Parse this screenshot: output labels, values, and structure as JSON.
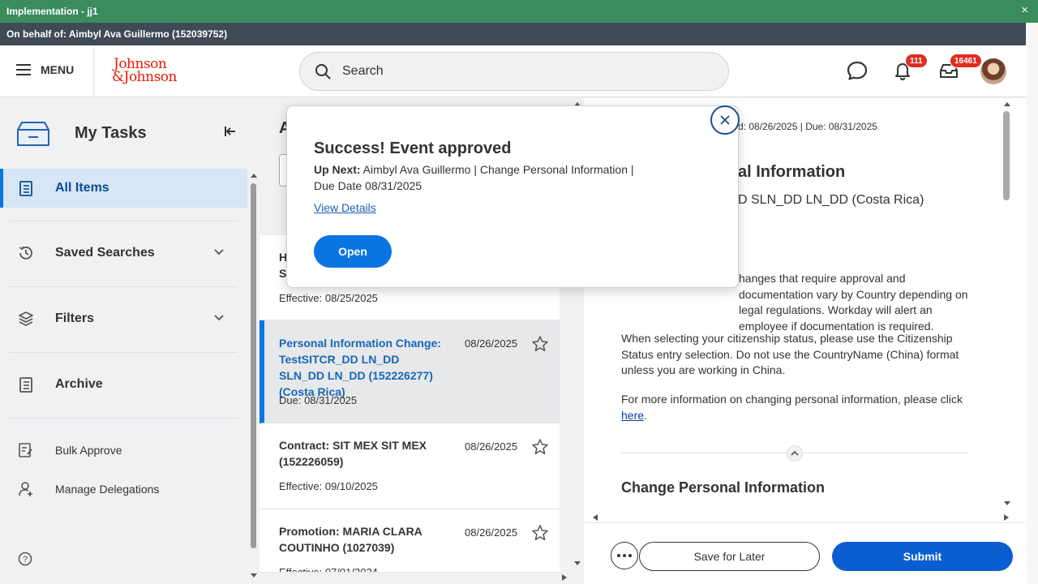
{
  "implementation_bar": {
    "title": "Implementation - jj1",
    "close": "×"
  },
  "behalf_bar": {
    "text": "On behalf of: Aimbyl Ava Guillermo (152039752)"
  },
  "header": {
    "menu_label": "MENU",
    "logo_line1": "Johnson",
    "logo_line2": "&Johnson",
    "search_placeholder": "Search",
    "notifications_count": "111",
    "inbox_count": "16461"
  },
  "sidebar": {
    "title": "My Tasks",
    "items": [
      {
        "label": "All Items"
      },
      {
        "label": "Saved Searches"
      },
      {
        "label": "Filters"
      },
      {
        "label": "Archive"
      },
      {
        "label": "Bulk Approve"
      },
      {
        "label": "Manage Delegations"
      }
    ]
  },
  "list": {
    "heading": "A",
    "tasks": [
      {
        "title_line1": "H",
        "title_line2": "S",
        "date": "",
        "sub": "Effective: 08/25/2025"
      },
      {
        "title": "Personal Information Change: TestSITCR_DD LN_DD SLN_DD LN_DD (152226277) (Costa Rica)",
        "date": "08/26/2025",
        "sub": "Due: 08/31/2025"
      },
      {
        "title": "Contract: SIT MEX SIT MEX (152226059)",
        "date": "08/26/2025",
        "sub": "Effective: 09/10/2025"
      },
      {
        "title": "Promotion: MARIA CLARA COUTINHO (1027039)",
        "date": "08/26/2025",
        "sub": "Effective: 07/01/2024"
      }
    ]
  },
  "detail": {
    "meta": "ted: 08/26/2025 | Due: 08/31/2025",
    "title": "al Information",
    "subtitle": "D SLN_DD LN_DD (Costa Rica)",
    "p1": "hanges that require approval and documentation vary by Country depending on legal regulations. Workday will alert an employee if documentation is required.",
    "p1_lead": "",
    "p2": "When selecting your citizenship status, please use the Citizenship Status entry selection.  Do not use the CountryName (China) format unless you are working in China.",
    "p3_text": "For more information on changing personal information, please click ",
    "p3_link": "here",
    "p3_end": ".",
    "section": "Change Personal Information",
    "save_label": "Save for Later",
    "submit_label": "Submit"
  },
  "popup": {
    "title": "Success! Event approved",
    "up_next_label": "Up Next:",
    "up_next_text": " Aimbyl Ava Guillermo | Change Personal Information | Due Date 08/31/2025",
    "link": "View Details",
    "open_label": "Open"
  },
  "colors": {
    "impl_bar": "#3a8c5c",
    "behalf_bar": "#3e4b57",
    "brand_red": "#eb1700",
    "primary_blue": "#0875e1",
    "submit_blue": "#0b5ed0",
    "badge_red": "#de2e21"
  }
}
